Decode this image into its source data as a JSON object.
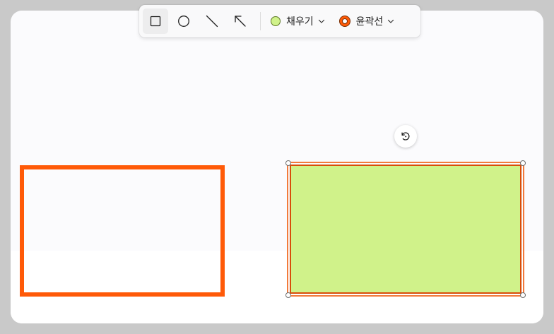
{
  "toolbar": {
    "tools": [
      {
        "name": "rectangle",
        "icon": "rectangle-icon",
        "active": true
      },
      {
        "name": "ellipse",
        "icon": "circle-icon",
        "active": false
      },
      {
        "name": "line",
        "icon": "line-icon",
        "active": false
      },
      {
        "name": "arrow",
        "icon": "arrow-icon",
        "active": false
      }
    ],
    "fill": {
      "label": "채우기",
      "color": "#d0f28a",
      "icon": "chevron-down-icon"
    },
    "outline": {
      "label": "윤곽선",
      "color": "#ff5a08",
      "icon": "chevron-down-icon"
    }
  },
  "colors": {
    "background": "#fbfbfd",
    "outline_shape_stroke": "#ff5a08",
    "selected_fill": "#d0f28a",
    "selected_stroke": "#d84d0a"
  },
  "canvas": {
    "shapes": [
      {
        "type": "rectangle",
        "fill": "none",
        "stroke": "#ff5a08",
        "selected": false
      },
      {
        "type": "rectangle",
        "fill": "#d0f28a",
        "stroke": "#d84d0a",
        "selected": true
      }
    ],
    "rotate_handle_icon": "rotate-icon"
  }
}
